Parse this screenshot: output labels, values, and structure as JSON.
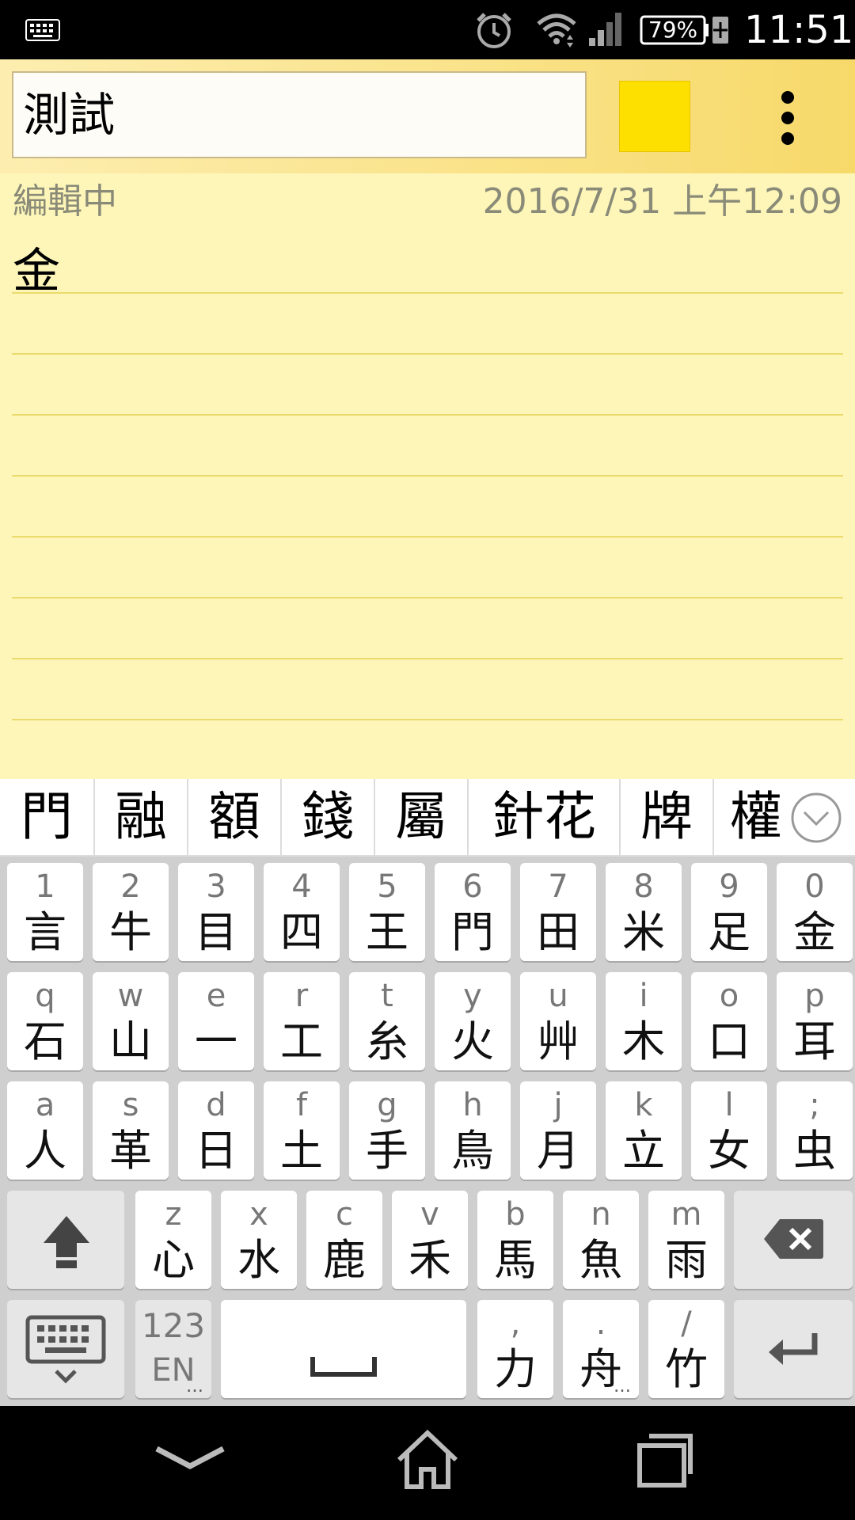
{
  "status_bar": {
    "battery": "79%",
    "time": "11:51",
    "icons": [
      "keyboard-icon",
      "alarm-icon",
      "wifi-icon",
      "signal-icon",
      "battery-charging-icon"
    ]
  },
  "note": {
    "title": "測試",
    "color": "#fde000",
    "status": "編輯中",
    "timestamp": "2016/7/31 上午12:09",
    "content": "金"
  },
  "candidates": [
    "門",
    "融",
    "額",
    "錢",
    "屬",
    "針花",
    "牌",
    "權"
  ],
  "keyboard": {
    "row1": [
      {
        "sec": "1",
        "pri": "言"
      },
      {
        "sec": "2",
        "pri": "牛"
      },
      {
        "sec": "3",
        "pri": "目"
      },
      {
        "sec": "4",
        "pri": "四"
      },
      {
        "sec": "5",
        "pri": "王"
      },
      {
        "sec": "6",
        "pri": "門"
      },
      {
        "sec": "7",
        "pri": "田"
      },
      {
        "sec": "8",
        "pri": "米"
      },
      {
        "sec": "9",
        "pri": "足"
      },
      {
        "sec": "0",
        "pri": "金"
      }
    ],
    "row2": [
      {
        "sec": "q",
        "pri": "石"
      },
      {
        "sec": "w",
        "pri": "山"
      },
      {
        "sec": "e",
        "pri": "一"
      },
      {
        "sec": "r",
        "pri": "工"
      },
      {
        "sec": "t",
        "pri": "糸"
      },
      {
        "sec": "y",
        "pri": "火"
      },
      {
        "sec": "u",
        "pri": "艸"
      },
      {
        "sec": "i",
        "pri": "木"
      },
      {
        "sec": "o",
        "pri": "口"
      },
      {
        "sec": "p",
        "pri": "耳"
      }
    ],
    "row3": [
      {
        "sec": "a",
        "pri": "人"
      },
      {
        "sec": "s",
        "pri": "革"
      },
      {
        "sec": "d",
        "pri": "日"
      },
      {
        "sec": "f",
        "pri": "土"
      },
      {
        "sec": "g",
        "pri": "手"
      },
      {
        "sec": "h",
        "pri": "鳥"
      },
      {
        "sec": "j",
        "pri": "月"
      },
      {
        "sec": "k",
        "pri": "立"
      },
      {
        "sec": "l",
        "pri": "女"
      },
      {
        "sec": ";",
        "pri": "虫"
      }
    ],
    "row4": [
      {
        "sec": "z",
        "pri": "心"
      },
      {
        "sec": "x",
        "pri": "水"
      },
      {
        "sec": "c",
        "pri": "鹿"
      },
      {
        "sec": "v",
        "pri": "禾"
      },
      {
        "sec": "b",
        "pri": "馬"
      },
      {
        "sec": "n",
        "pri": "魚"
      },
      {
        "sec": "m",
        "pri": "雨"
      }
    ],
    "mode_key": {
      "top": "123",
      "bottom": "EN"
    },
    "row5": [
      {
        "sec": ",",
        "pri": "力"
      },
      {
        "sec": ".",
        "pri": "舟"
      },
      {
        "sec": "/",
        "pri": "竹"
      }
    ]
  },
  "nav_bar": {
    "icons": [
      "back-icon",
      "home-icon",
      "recents-icon"
    ]
  }
}
